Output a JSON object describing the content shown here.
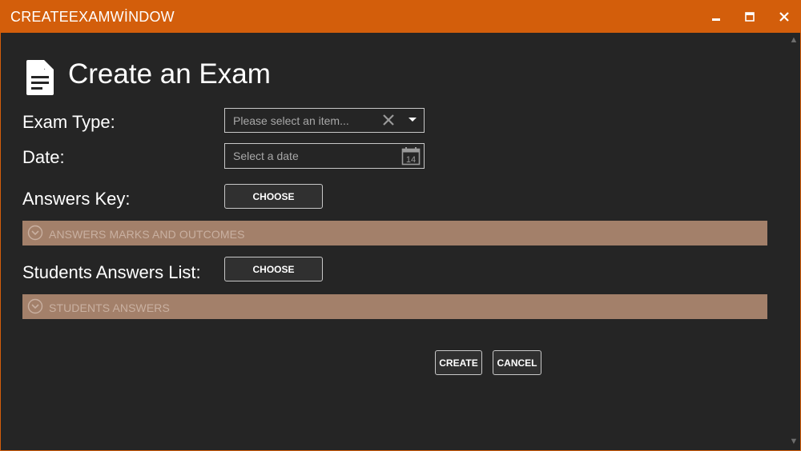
{
  "window": {
    "title": "CREATEEXAMWİNDOW",
    "accent": "#d35e0b",
    "controls": {
      "minimize": "▁",
      "maximize": "▭",
      "close": "✕"
    }
  },
  "header": {
    "title": "Create an Exam",
    "icon": "document-icon"
  },
  "form": {
    "exam_type": {
      "label": "Exam Type:",
      "placeholder": "Please select an item...",
      "clear_glyph": "✕"
    },
    "date": {
      "label": "Date:",
      "placeholder": "Select a date",
      "calendar_day": "14"
    },
    "answers_key": {
      "label": "Answers Key:",
      "button": "CHOOSE"
    },
    "answers_marks_expander": {
      "label": "ANSWERS MARKS AND OUTCOMES",
      "color": "#a3806a"
    },
    "students_answers_list": {
      "label": "Students Answers List:",
      "button": "CHOOSE"
    },
    "students_answers_expander": {
      "label": "STUDENTS ANSWERS",
      "color": "#a3806a"
    }
  },
  "actions": {
    "create": "CREATE",
    "cancel": "CANCEL"
  },
  "scrollbar": {
    "up": "▲",
    "down": "▼"
  }
}
